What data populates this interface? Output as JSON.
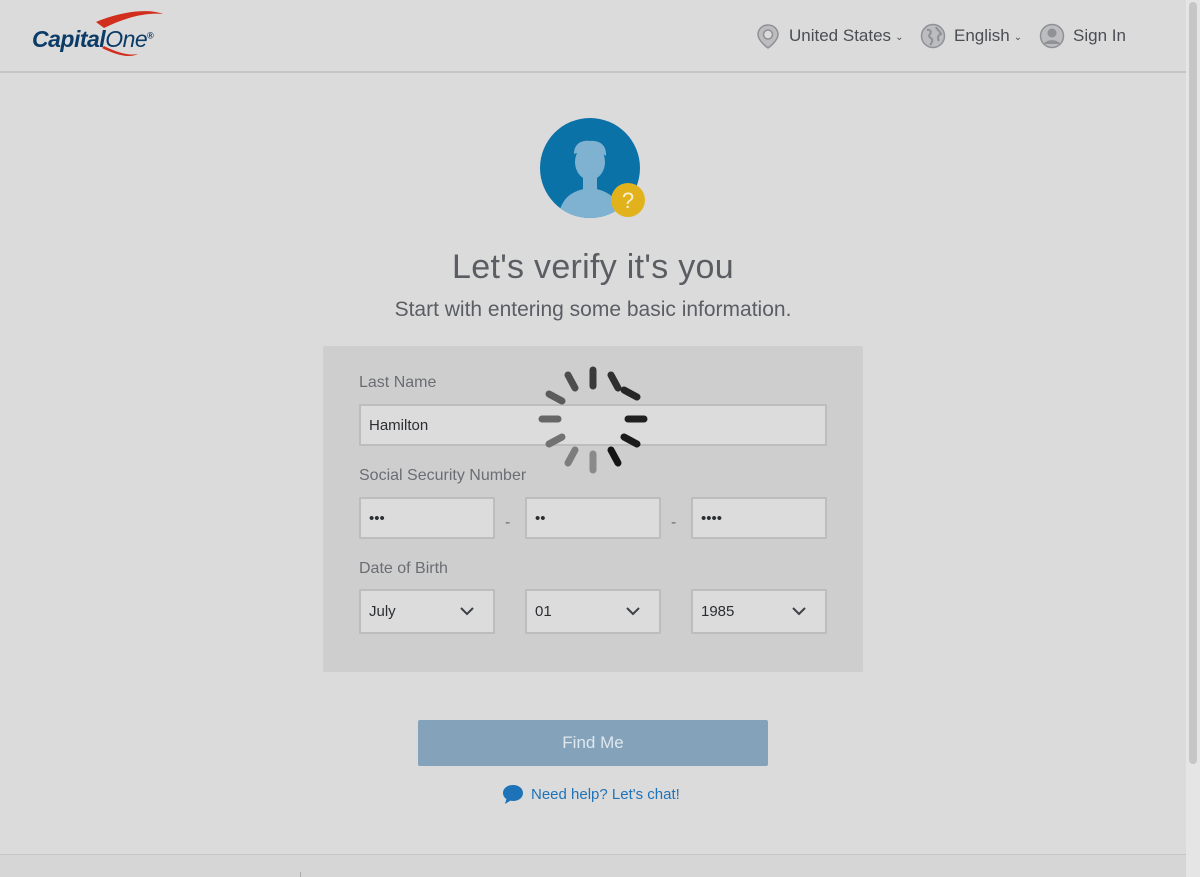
{
  "header": {
    "logo_text_bold": "Capital",
    "logo_text_italic": "One",
    "logo_mark": "®",
    "country_label": "United States",
    "language_label": "English",
    "signin_label": "Sign In",
    "icons": [
      "location-pin-icon",
      "globe-icon",
      "user-circle-icon"
    ]
  },
  "main": {
    "title": "Let's verify it's you",
    "subtitle": "Start with entering some basic information."
  },
  "form": {
    "last_name_label": "Last Name",
    "last_name_value": "Hamilton",
    "ssn_label": "Social Security Number",
    "ssn_part1": "•••",
    "ssn_part2": "••",
    "ssn_part3": "••••",
    "ssn_separator": "-",
    "dob_label": "Date of Birth",
    "dob_month": "July",
    "dob_day": "01",
    "dob_year": "1985"
  },
  "actions": {
    "find_me_label": "Find Me",
    "help_label": "Need help? Let's chat!"
  },
  "colors": {
    "background": "#dcdbdc",
    "brand_navy": "#0b3b67",
    "brand_red": "#d22e1e",
    "button_disabled": "#84a3bb",
    "link_blue": "#1e73b8",
    "avatar_blue": "#0b72a8",
    "badge_yellow": "#e2b21c"
  },
  "state": {
    "loading_spinner_visible": true
  }
}
